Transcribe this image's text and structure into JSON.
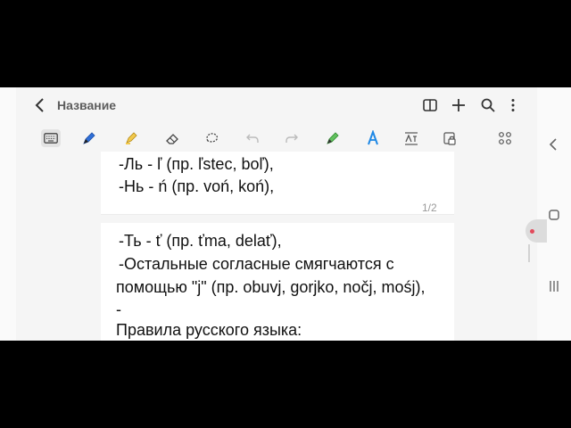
{
  "header": {
    "title": "Название",
    "icons": [
      "back-icon",
      "book-icon",
      "plus-icon",
      "search-icon",
      "more-vert-icon"
    ]
  },
  "toolbar": {
    "icons": [
      "keyboard-icon",
      "pen-icon",
      "highlighter-icon",
      "eraser-icon",
      "lasso-icon",
      "undo-icon",
      "redo-icon",
      "ai-pen-icon",
      "text-style-icon",
      "text-recognize-icon",
      "lock-icon",
      "more-tools-icon"
    ]
  },
  "page1": {
    "lines": [
      "-Ль - ľ (пр. ľstec, boľ),",
      "-Нь - ń (пр. voń, koń),"
    ],
    "page_number": "1/2"
  },
  "page2": {
    "lines": [
      "-Ть - ť (пр. ťma, delať),",
      "-Остальные согласные смягчаются с",
      "помощью \"j\" (пр. obuvj, gorjko, nočj, mośj),",
      "-",
      "Правила русского языка:"
    ]
  },
  "side": {
    "icons": [
      "chevron-left-icon",
      "recents-icon",
      "home-icon",
      "menu-icon"
    ]
  },
  "colors": {
    "accent": "#5b5bd6",
    "pen_blue": "#2f6fd8",
    "highlighter_yellow": "#f2c94c",
    "ai_green": "#62c15f",
    "text_style_blue": "#1e88e5"
  }
}
